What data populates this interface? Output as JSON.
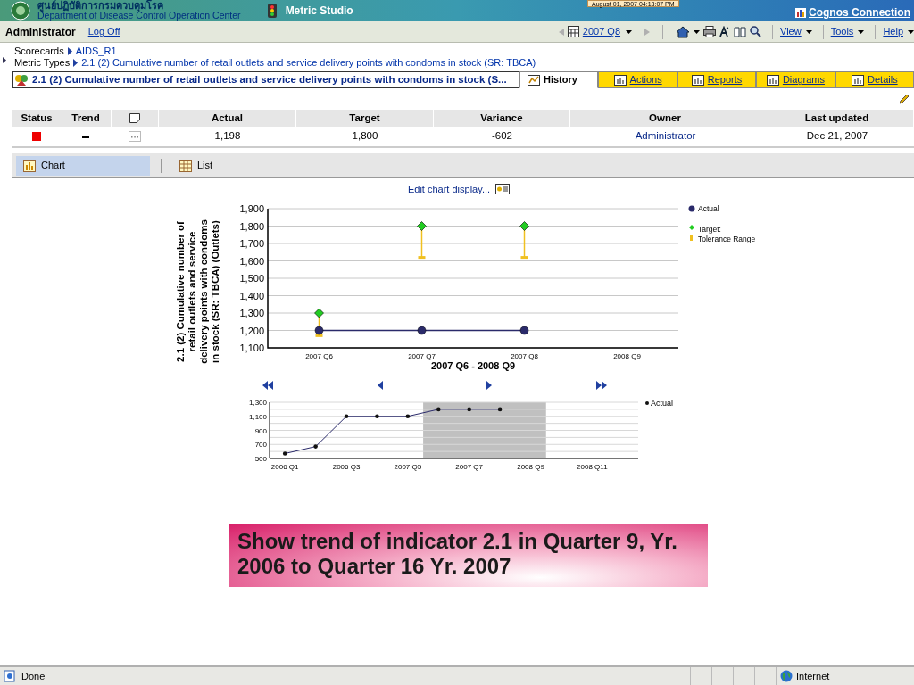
{
  "header": {
    "org_thai": "ศูนย์ปฏิบัติการกรมควบคุมโรค",
    "org_english": "Department of Disease Control Operation Center",
    "app": "Metric Studio",
    "clock": "August 01, 2007 04:13:07 PM",
    "connection_link": "Cognos Connection"
  },
  "toolbar": {
    "user": "Administrator",
    "logoff": "Log Off",
    "period": "2007 Q8",
    "menus": [
      "View",
      "Tools",
      "Help"
    ]
  },
  "breadcrumbs": [
    {
      "label": "Scorecards",
      "link": "AIDS_R1"
    },
    {
      "label": "Metric Types",
      "link": "2.1 (2) Cumulative number of retail outlets and service delivery points with condoms in stock (SR: TBCA)"
    }
  ],
  "metric_title": "2.1 (2) Cumulative number of retail outlets and service delivery points with condoms in stock (S...",
  "tabs": [
    {
      "label": "History",
      "selected": true
    },
    {
      "label": "Actions",
      "selected": false
    },
    {
      "label": "Reports",
      "selected": false
    },
    {
      "label": "Diagrams",
      "selected": false
    },
    {
      "label": "Details",
      "selected": false
    }
  ],
  "table": {
    "columns": [
      "Status",
      "Trend",
      "Actual",
      "Target",
      "Variance",
      "Owner",
      "Last updated"
    ],
    "rows": [
      {
        "color": "#ee0000",
        "actual": "1,198",
        "target": "1,800",
        "variance": "-602",
        "owner": "Administrator",
        "last_updated": "Dec 21, 2007"
      }
    ]
  },
  "view_tabs": [
    {
      "label": "Chart",
      "kind": "chart",
      "selected": true
    },
    {
      "label": "List",
      "kind": "list",
      "selected": false
    }
  ],
  "edit_chart_link": "Edit chart display...",
  "main_chart": {
    "chart_data": {
      "type": "line",
      "grid": true,
      "legend": "right",
      "xlabel": "2007 Q6 - 2008 Q9",
      "ylabel": "2.1 (2) Cumulative number of retail outlets and service delivery points with condoms in stock (SR: TBCA) (Outlets)",
      "categories": [
        "2007 Q6",
        "2007 Q7",
        "2007 Q8",
        "2008 Q9"
      ],
      "ylim": [
        1100,
        1900
      ],
      "yticks": [
        {
          "value": 1100,
          "label": "1,100"
        },
        {
          "value": 1200,
          "label": "1,200"
        },
        {
          "value": 1300,
          "label": "1,300"
        },
        {
          "value": 1400,
          "label": "1,400"
        },
        {
          "value": 1500,
          "label": "1,500"
        },
        {
          "value": 1600,
          "label": "1,600"
        },
        {
          "value": 1700,
          "label": "1,700"
        },
        {
          "value": 1800,
          "label": "1,800"
        },
        {
          "value": 1900,
          "label": "1,900"
        }
      ],
      "series": [
        {
          "name": "Actual",
          "type": "line",
          "marker": true,
          "color": "#2a2a6a",
          "values": [
            1200,
            1200,
            1200,
            null
          ]
        },
        {
          "name": "Target:",
          "type": "scatter",
          "color": "#22cc22",
          "values": [
            1300,
            1800,
            1800,
            null
          ]
        },
        {
          "name": "Tolerance Range",
          "type": "scatter",
          "color": "#f0c020",
          "values": [
            1170,
            1620,
            1620,
            null
          ]
        }
      ]
    }
  },
  "overview_chart": {
    "chart_data": {
      "type": "line",
      "grid": true,
      "categories": [
        "2006 Q1",
        null,
        "2006 Q3",
        null,
        "2007 Q5",
        null,
        "2007 Q7",
        null,
        "2008 Q9",
        null,
        "2008 Q11",
        null
      ],
      "ylim": [
        500,
        1300
      ],
      "yticks": [
        {
          "value": 500,
          "label": "500"
        },
        {
          "value": 700,
          "label": "700"
        },
        {
          "value": 900,
          "label": "900"
        },
        {
          "value": 1100,
          "label": "1,100"
        },
        {
          "value": 1300,
          "label": "1,300"
        }
      ],
      "series": [
        {
          "name": "Actual",
          "color": "#2a2a6a",
          "values": [
            570,
            670,
            1100,
            1100,
            1100,
            1200,
            1200,
            1200,
            null,
            null,
            null,
            null
          ]
        }
      ]
    }
  },
  "annotation": "Show trend of indicator 2.1 in Quarter 9, Yr. 2006 to Quarter 16 Yr. 2007",
  "status_bar": {
    "message": "Done",
    "zone": "Internet"
  }
}
